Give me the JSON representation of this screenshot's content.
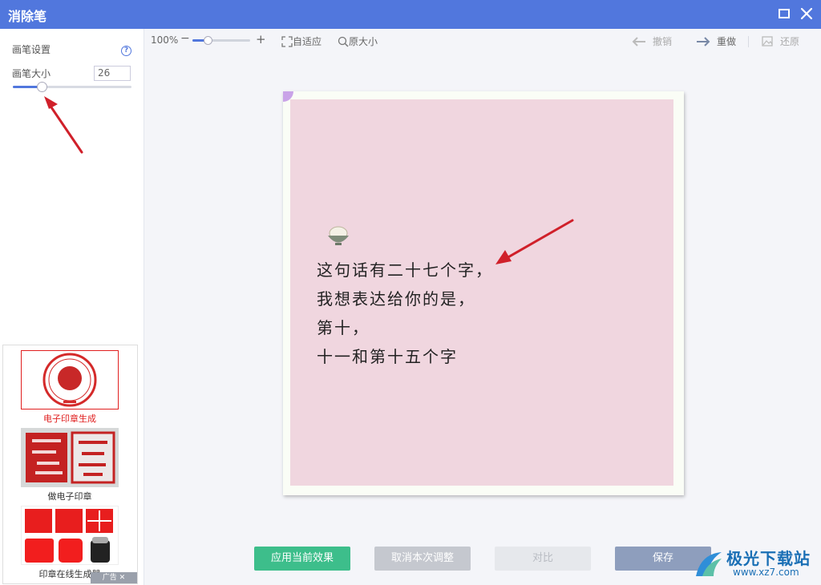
{
  "window": {
    "title": "消除笔"
  },
  "left_panel": {
    "section_title": "画笔设置",
    "size_label": "画笔大小",
    "size_value": "26",
    "size_slider_fraction": 0.24
  },
  "ads": {
    "items": [
      {
        "caption": "电子印章生成",
        "active": true
      },
      {
        "caption": "做电子印章",
        "active": false
      },
      {
        "caption": "印章在线生成器",
        "active": false
      }
    ],
    "footer": "广告"
  },
  "toolbar": {
    "zoom": "100%",
    "zoom_out": "−",
    "zoom_in": "+",
    "fit": "自适应",
    "original": "原大小",
    "undo": "撤销",
    "redo": "重做",
    "restore": "还原"
  },
  "photo": {
    "lines": [
      "这句话有二十七个字，",
      "我想表达给你的是，",
      "第十，",
      "十一和第十五个字"
    ]
  },
  "bottom": {
    "apply": "应用当前效果",
    "cancel": "取消本次调整",
    "compare": "对比",
    "save": "保存"
  },
  "watermark": {
    "name": "极光下载站",
    "url": "www.xz7.com"
  },
  "colors": {
    "titlebar": "#5177dd",
    "accent": "#5177dd",
    "apply": "#3dbe8b",
    "arrow": "#d0202a"
  }
}
